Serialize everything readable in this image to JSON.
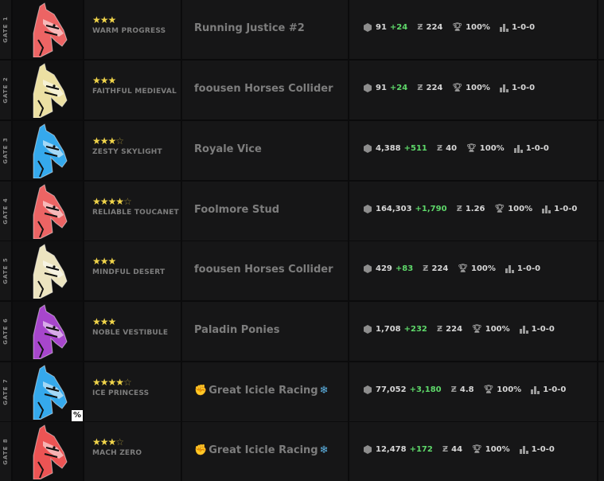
{
  "rows": [
    {
      "gate": "GATE 1",
      "stars": "★★★",
      "half": "",
      "horse": "WARM PROGRESS",
      "color": "#ff6b6b",
      "owner": "Running Justice #2",
      "owner_icon": "",
      "owner_suffix": "",
      "badge": "",
      "value": "91",
      "gain": "+24",
      "z": "224",
      "win": "100%",
      "record": "1-0-0"
    },
    {
      "gate": "GATE 2",
      "stars": "★★★",
      "half": "",
      "horse": "FAITHFUL MEDIEVAL",
      "color": "#fff2b0",
      "owner": "foousen Horses Collider",
      "owner_icon": "",
      "owner_suffix": "",
      "badge": "",
      "value": "91",
      "gain": "+24",
      "z": "224",
      "win": "100%",
      "record": "1-0-0"
    },
    {
      "gate": "GATE 3",
      "stars": "★★★",
      "half": "☆",
      "horse": "ZESTY SKYLIGHT",
      "color": "#38b6ff",
      "owner": "Royale Vice",
      "owner_icon": "",
      "owner_suffix": "",
      "badge": "",
      "value": "4,388",
      "gain": "+511",
      "z": "40",
      "win": "100%",
      "record": "1-0-0"
    },
    {
      "gate": "GATE 4",
      "stars": "★★★★",
      "half": "☆",
      "horse": "RELIABLE TOUCANET",
      "color": "#ff6b6b",
      "owner": "Foolmore Stud",
      "owner_icon": "",
      "owner_suffix": "",
      "badge": "",
      "value": "164,303",
      "gain": "+1,790",
      "z": "1.26",
      "win": "100%",
      "record": "1-0-0"
    },
    {
      "gate": "GATE 5",
      "stars": "★★★",
      "half": "",
      "horse": "MINDFUL DESERT",
      "color": "#fff6cf",
      "owner": "foousen Horses Collider",
      "owner_icon": "",
      "owner_suffix": "",
      "badge": "",
      "value": "429",
      "gain": "+83",
      "z": "224",
      "win": "100%",
      "record": "1-0-0"
    },
    {
      "gate": "GATE 6",
      "stars": "★★★",
      "half": "",
      "horse": "NOBLE VESTIBULE",
      "color": "#b44bdc",
      "owner": "Paladin Ponies",
      "owner_icon": "",
      "owner_suffix": "",
      "badge": "",
      "value": "1,708",
      "gain": "+232",
      "z": "224",
      "win": "100%",
      "record": "1-0-0"
    },
    {
      "gate": "GATE 7",
      "stars": "★★★★",
      "half": "☆",
      "horse": "ICE PRINCESS",
      "color": "#38b6ff",
      "owner": "Great Icicle Racing",
      "owner_icon": "✊",
      "owner_suffix": "❄",
      "badge": "%",
      "value": "77,052",
      "gain": "+3,180",
      "z": "4.8",
      "win": "100%",
      "record": "1-0-0"
    },
    {
      "gate": "GATE 8",
      "stars": "★★★",
      "half": "☆",
      "horse": "MACH ZERO",
      "color": "#ff5a5a",
      "owner": "Great Icicle Racing",
      "owner_icon": "✊",
      "owner_suffix": "❄",
      "badge": "",
      "value": "12,478",
      "gain": "+172",
      "z": "44",
      "win": "100%",
      "record": "1-0-0"
    }
  ]
}
